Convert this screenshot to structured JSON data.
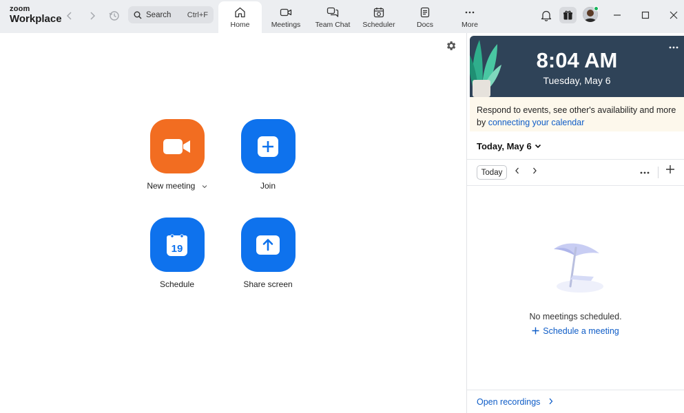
{
  "app": {
    "logo_line1": "zoom",
    "logo_line2": "Workplace"
  },
  "search": {
    "placeholder": "Search",
    "shortcut": "Ctrl+F"
  },
  "tabs": [
    {
      "label": "Home",
      "icon": "home-icon",
      "active": true
    },
    {
      "label": "Meetings",
      "icon": "video-icon"
    },
    {
      "label": "Team Chat",
      "icon": "chat-icon"
    },
    {
      "label": "Scheduler",
      "icon": "calendar-clock-icon"
    },
    {
      "label": "Docs",
      "icon": "doc-icon"
    },
    {
      "label": "More",
      "icon": "more-icon"
    }
  ],
  "actions": [
    {
      "label": "New meeting",
      "icon": "video-camera-icon",
      "color": "#f26d21"
    },
    {
      "label": "Join",
      "icon": "plus-icon",
      "color": "#0e72ed"
    },
    {
      "label": "Schedule",
      "icon": "calendar-icon",
      "calendar_day": "19",
      "color": "#0e72ed"
    },
    {
      "label": "Share screen",
      "icon": "share-arrow-icon",
      "color": "#0e72ed"
    }
  ],
  "clock": {
    "time": "8:04 AM",
    "date": "Tuesday, May 6"
  },
  "banner": {
    "text": "Respond to events, see other's availability and more by ",
    "link": "connecting your calendar"
  },
  "calendar": {
    "header": "Today, May 6",
    "today_button": "Today",
    "empty_text": "No meetings scheduled.",
    "schedule_link": "Schedule a meeting",
    "recordings_link": "Open recordings"
  },
  "colors": {
    "accent": "#0e72ed",
    "orange": "#f26d21",
    "clock_bg": "#2f4358",
    "link": "#0e5cc7"
  }
}
